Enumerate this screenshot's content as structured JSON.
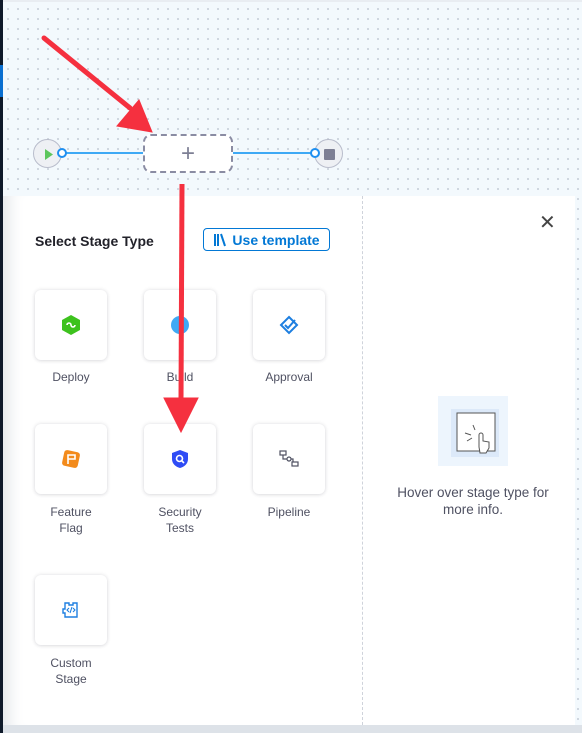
{
  "canvas": {
    "add_stage_symbol": "+",
    "start_icon": "play-icon",
    "end_icon": "stop-icon"
  },
  "panel": {
    "title": "Select Stage Type",
    "use_template_label": "Use template",
    "close_icon": "close-icon",
    "stage_types": [
      {
        "label": "Deploy",
        "icon": "deploy-icon",
        "color": "#3dc21e"
      },
      {
        "label": "Build",
        "icon": "build-icon",
        "color": "#3fa9f5"
      },
      {
        "label": "Approval",
        "icon": "approval-icon",
        "color": "#1e7fe0"
      },
      {
        "label_line1": "Feature",
        "label_line2": "Flag",
        "icon": "feature-flag-icon",
        "color": "#f38b1c"
      },
      {
        "label_line1": "Security",
        "label_line2": "Tests",
        "icon": "security-tests-icon",
        "color": "#2f4cf5"
      },
      {
        "label": "Pipeline",
        "icon": "pipeline-icon",
        "color": "#4f5162"
      },
      {
        "label_line1": "Custom",
        "label_line2": "Stage",
        "icon": "custom-stage-icon",
        "color": "#1e7fe0"
      }
    ],
    "hover_info": "Hover over stage type for more info."
  },
  "annotation_color": "#f5303f"
}
